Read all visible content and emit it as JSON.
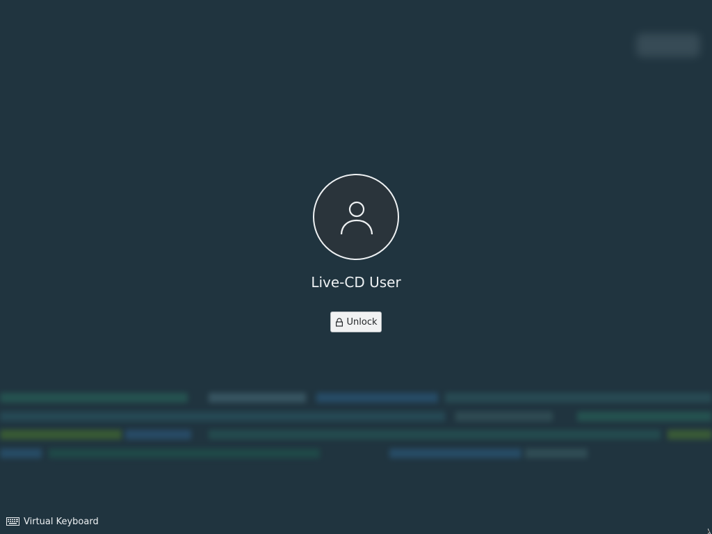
{
  "user": {
    "name": "Live-CD User",
    "avatar_icon": "user-avatar-icon"
  },
  "unlock": {
    "label": "Unlock",
    "icon": "lock-icon"
  },
  "footer": {
    "virtual_keyboard_label": "Virtual Keyboard",
    "icon": "keyboard-icon"
  },
  "colors": {
    "background": "#20343f",
    "avatar_fill": "#2a343b",
    "text": "#eef1f3",
    "button_bg": "#f1f2f3"
  }
}
